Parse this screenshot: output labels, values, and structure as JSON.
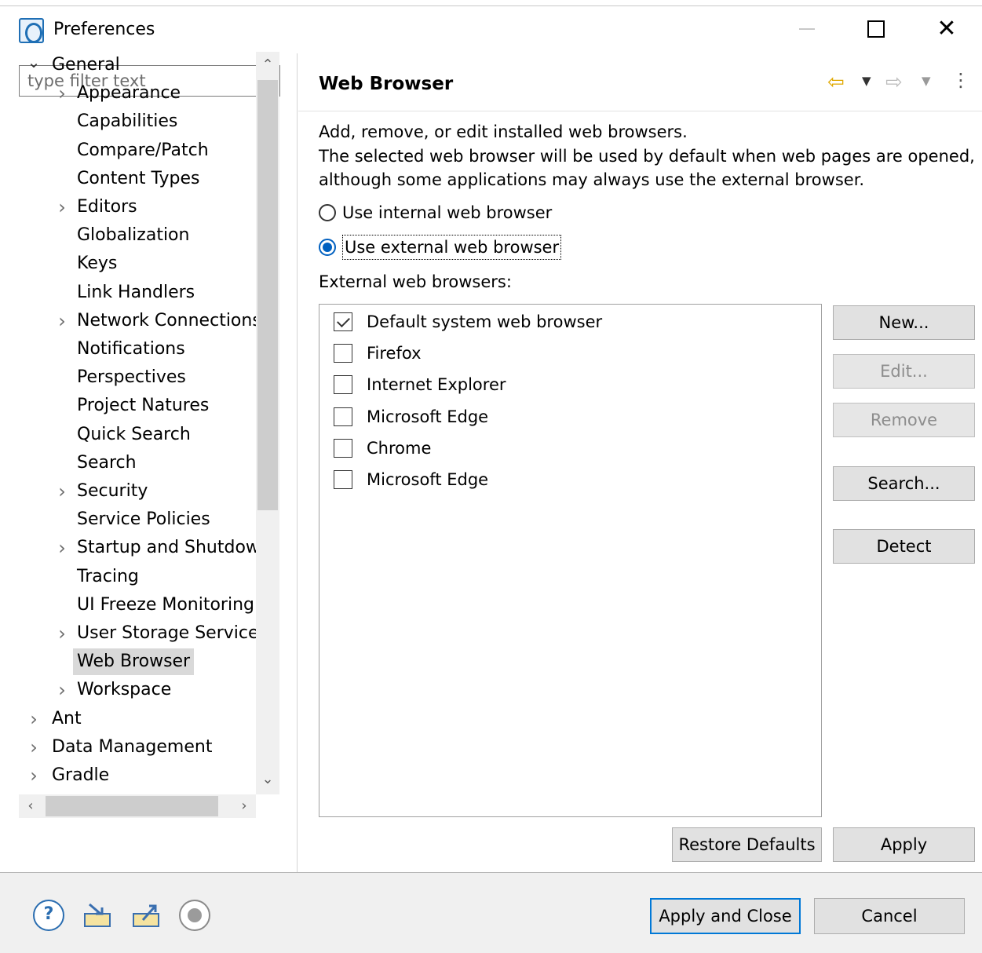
{
  "window": {
    "title": "Preferences",
    "minimize_glyph": "—",
    "maximize_glyph": "□",
    "close_glyph": "✕"
  },
  "filter": {
    "placeholder": "type filter text",
    "value": ""
  },
  "tree": {
    "items": [
      {
        "label": "General",
        "level": 0,
        "arrow": "expanded",
        "selected": false
      },
      {
        "label": "Appearance",
        "level": 1,
        "arrow": "collapsed",
        "selected": false
      },
      {
        "label": "Capabilities",
        "level": 1,
        "arrow": "none",
        "selected": false
      },
      {
        "label": "Compare/Patch",
        "level": 1,
        "arrow": "none",
        "selected": false
      },
      {
        "label": "Content Types",
        "level": 1,
        "arrow": "none",
        "selected": false
      },
      {
        "label": "Editors",
        "level": 1,
        "arrow": "collapsed",
        "selected": false
      },
      {
        "label": "Globalization",
        "level": 1,
        "arrow": "none",
        "selected": false
      },
      {
        "label": "Keys",
        "level": 1,
        "arrow": "none",
        "selected": false
      },
      {
        "label": "Link Handlers",
        "level": 1,
        "arrow": "none",
        "selected": false
      },
      {
        "label": "Network Connections",
        "level": 1,
        "arrow": "collapsed",
        "selected": false
      },
      {
        "label": "Notifications",
        "level": 1,
        "arrow": "none",
        "selected": false
      },
      {
        "label": "Perspectives",
        "level": 1,
        "arrow": "none",
        "selected": false
      },
      {
        "label": "Project Natures",
        "level": 1,
        "arrow": "none",
        "selected": false
      },
      {
        "label": "Quick Search",
        "level": 1,
        "arrow": "none",
        "selected": false
      },
      {
        "label": "Search",
        "level": 1,
        "arrow": "none",
        "selected": false
      },
      {
        "label": "Security",
        "level": 1,
        "arrow": "collapsed",
        "selected": false
      },
      {
        "label": "Service Policies",
        "level": 1,
        "arrow": "none",
        "selected": false
      },
      {
        "label": "Startup and Shutdown",
        "level": 1,
        "arrow": "collapsed",
        "selected": false
      },
      {
        "label": "Tracing",
        "level": 1,
        "arrow": "none",
        "selected": false
      },
      {
        "label": "UI Freeze Monitoring",
        "level": 1,
        "arrow": "none",
        "selected": false
      },
      {
        "label": "User Storage Service",
        "level": 1,
        "arrow": "collapsed",
        "selected": false
      },
      {
        "label": "Web Browser",
        "level": 1,
        "arrow": "none",
        "selected": true
      },
      {
        "label": "Workspace",
        "level": 1,
        "arrow": "collapsed",
        "selected": false
      },
      {
        "label": "Ant",
        "level": 0,
        "arrow": "collapsed",
        "selected": false
      },
      {
        "label": "Data Management",
        "level": 0,
        "arrow": "collapsed",
        "selected": false
      },
      {
        "label": "Gradle",
        "level": 0,
        "arrow": "collapsed",
        "selected": false
      }
    ]
  },
  "page": {
    "title": "Web Browser",
    "description_lines": [
      "Add, remove, or edit installed web browsers.",
      "The selected web browser will be used by default when web pages are opened,",
      "although some applications may always use the external browser."
    ],
    "radio_internal": {
      "label": "Use internal web browser",
      "checked": false
    },
    "radio_external": {
      "label": "Use external web browser",
      "checked": true
    },
    "external_label": "External web browsers:",
    "browsers": [
      {
        "name": "Default system web browser",
        "checked": true
      },
      {
        "name": "Firefox",
        "checked": false
      },
      {
        "name": "Internet Explorer",
        "checked": false
      },
      {
        "name": "Microsoft Edge",
        "checked": false
      },
      {
        "name": "Chrome",
        "checked": false
      },
      {
        "name": "Microsoft Edge",
        "checked": false
      }
    ],
    "buttons": {
      "new": "New...",
      "edit": "Edit...",
      "remove": "Remove",
      "search": "Search...",
      "detect": "Detect",
      "restore_defaults": "Restore Defaults",
      "apply": "Apply"
    }
  },
  "footer": {
    "apply_and_close": "Apply and Close",
    "cancel": "Cancel"
  },
  "colors": {
    "accent": "#0078d7",
    "selection": "#d9d9d9",
    "back_arrow": "#e0a800",
    "dialog_bg": "#f0f0f0"
  }
}
